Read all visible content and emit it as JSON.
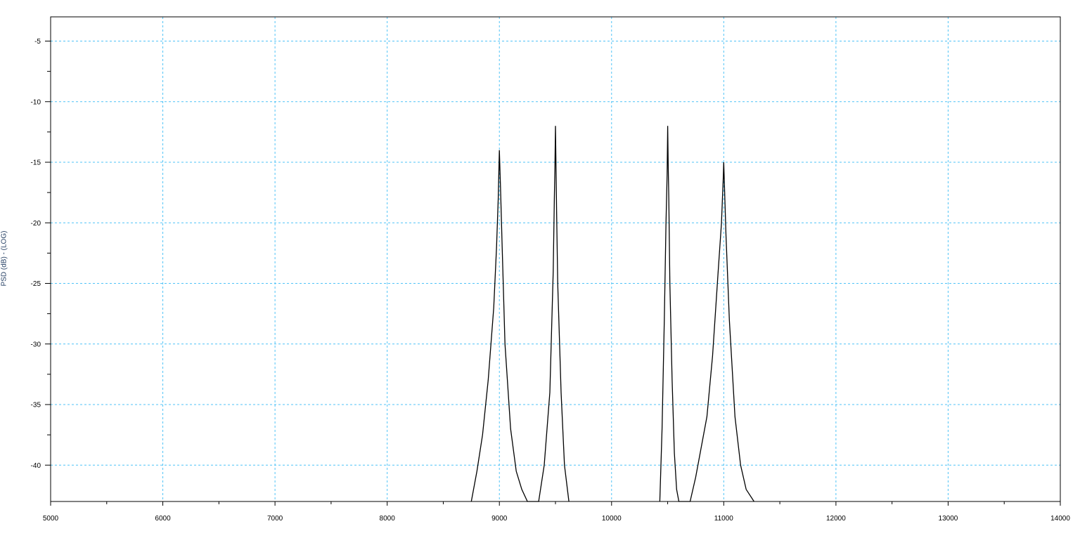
{
  "chart_data": {
    "type": "line",
    "title": "",
    "xlabel": "",
    "ylabel": "PSD (dB) - (LOG)",
    "xlim": [
      5000,
      14000
    ],
    "ylim": [
      -43,
      -3
    ],
    "x_ticks": [
      5000,
      6000,
      7000,
      8000,
      9000,
      10000,
      11000,
      12000,
      13000,
      14000
    ],
    "y_ticks": [
      -5,
      -10,
      -15,
      -20,
      -25,
      -30,
      -35,
      -40
    ],
    "grid": true,
    "colors": {
      "line": "#000000",
      "grid": "#4fc3f7",
      "axis": "#000000"
    },
    "series": [
      {
        "x": [
          8750,
          8800,
          8850,
          8900,
          8950,
          8975,
          8990,
          9000,
          9010,
          9025,
          9050,
          9100,
          9150,
          9200,
          9250,
          9300,
          9350,
          9400,
          9450,
          9480,
          9490,
          9495,
          9500,
          9505,
          9510,
          9520,
          9550,
          9580,
          9620
        ],
        "y": [
          -43,
          -40.5,
          -37.5,
          -33,
          -27,
          -22,
          -18,
          -14,
          -17,
          -22,
          -30,
          -37,
          -40.5,
          -42,
          -43,
          -43,
          -43,
          -40,
          -34,
          -24,
          -18,
          -15.5,
          -12,
          -15.5,
          -19,
          -25,
          -34,
          -40,
          -43
        ]
      },
      {
        "x": [
          10430,
          10450,
          10470,
          10485,
          10495,
          10500,
          10505,
          10510,
          10520,
          10540,
          10560,
          10580,
          10600,
          10650,
          10700,
          10750,
          10800,
          10850,
          10900,
          10950,
          10980,
          10995,
          11000,
          11005,
          11020,
          11050,
          11100,
          11150,
          11200,
          11270
        ],
        "y": [
          -43,
          -37,
          -28,
          -20,
          -16,
          -12,
          -15.5,
          -18,
          -25,
          -33,
          -39,
          -42,
          -43,
          -43,
          -43,
          -41,
          -38.5,
          -36,
          -31,
          -24,
          -20,
          -16.5,
          -15,
          -16.5,
          -21,
          -28,
          -36,
          -40,
          -42,
          -43
        ]
      }
    ]
  }
}
